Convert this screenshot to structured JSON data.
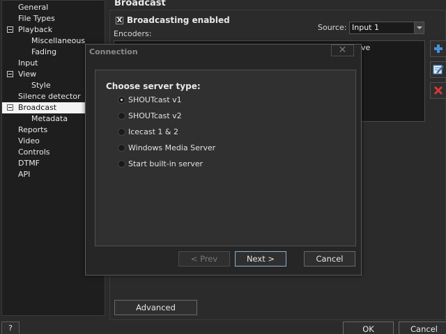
{
  "sidebar": {
    "items": [
      {
        "label": "General",
        "indent": 0,
        "expander": false,
        "selected": false
      },
      {
        "label": "File Types",
        "indent": 0,
        "expander": false,
        "selected": false
      },
      {
        "label": "Playback",
        "indent": 0,
        "expander": true,
        "selected": false
      },
      {
        "label": "Miscellaneous",
        "indent": 1,
        "expander": false,
        "selected": false
      },
      {
        "label": "Fading",
        "indent": 1,
        "expander": false,
        "selected": false
      },
      {
        "label": "Input",
        "indent": 0,
        "expander": false,
        "selected": false
      },
      {
        "label": "View",
        "indent": 0,
        "expander": true,
        "selected": false
      },
      {
        "label": "Style",
        "indent": 1,
        "expander": false,
        "selected": false
      },
      {
        "label": "Silence detector",
        "indent": 0,
        "expander": false,
        "selected": false
      },
      {
        "label": "Broadcast",
        "indent": 0,
        "expander": true,
        "selected": true
      },
      {
        "label": "Metadata",
        "indent": 1,
        "expander": false,
        "selected": false
      },
      {
        "label": "Reports",
        "indent": 0,
        "expander": false,
        "selected": false
      },
      {
        "label": "Video",
        "indent": 0,
        "expander": false,
        "selected": false
      },
      {
        "label": "Controls",
        "indent": 0,
        "expander": false,
        "selected": false
      },
      {
        "label": "DTMF",
        "indent": 0,
        "expander": false,
        "selected": false
      },
      {
        "label": "API",
        "indent": 0,
        "expander": false,
        "selected": false
      }
    ]
  },
  "panel": {
    "title": "Broadcast",
    "broadcasting_label": "Broadcasting enabled",
    "broadcasting_checked": "X",
    "encoders_label": "Encoders:",
    "source_label": "Source:",
    "source_value": "Input 1",
    "encoders_list_partial": "ve",
    "advanced_label": "Advanced"
  },
  "side_buttons": {
    "add_icon": "plus-icon",
    "edit_icon": "edit-icon",
    "remove_icon": "delete-icon"
  },
  "footer": {
    "help_label": "?",
    "ok_label": "OK",
    "cancel_label": "Cancel"
  },
  "dialog": {
    "title": "Connection",
    "close_label": "✕",
    "heading": "Choose server type:",
    "options": [
      {
        "label": "SHOUTcast v1",
        "selected": true
      },
      {
        "label": "SHOUTcast v2",
        "selected": false
      },
      {
        "label": "Icecast 1 & 2",
        "selected": false
      },
      {
        "label": "Windows Media Server",
        "selected": false
      },
      {
        "label": "Start built-in server",
        "selected": false
      }
    ],
    "prev_label": "< Prev",
    "next_label": "Next >",
    "cancel_label": "Cancel"
  },
  "colors": {
    "background": "#2b2b2b",
    "tree_background": "#1e1e1e",
    "selected_item": "#f4f4f4",
    "accent_blue": "#4a8fd8",
    "accent_red": "#d23a3a"
  }
}
